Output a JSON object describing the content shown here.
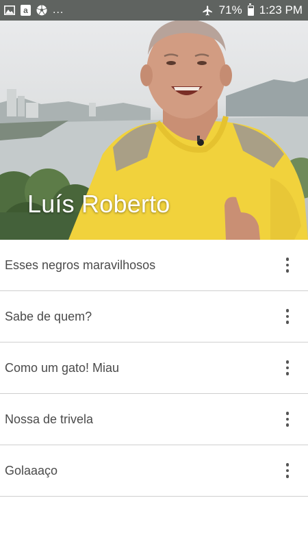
{
  "status_bar": {
    "icons_left": [
      "image-icon",
      "amazon-icon",
      "soccer-ball-icon"
    ],
    "overflow": "...",
    "airplane_mode": true,
    "battery": "71%",
    "battery_level": 0.71,
    "time": "1:23 PM"
  },
  "header": {
    "title": "Luís Roberto"
  },
  "sounds": [
    {
      "label": "Esses negros maravilhosos"
    },
    {
      "label": "Sabe de quem?"
    },
    {
      "label": "Como um gato! Miau"
    },
    {
      "label": "Nossa de trivela"
    },
    {
      "label": "Golaaaço"
    }
  ],
  "colors": {
    "status_bar": "#5f6360",
    "divider": "#cfcfcf",
    "text": "#4a4a4a",
    "shirt": "#f1d23c"
  }
}
